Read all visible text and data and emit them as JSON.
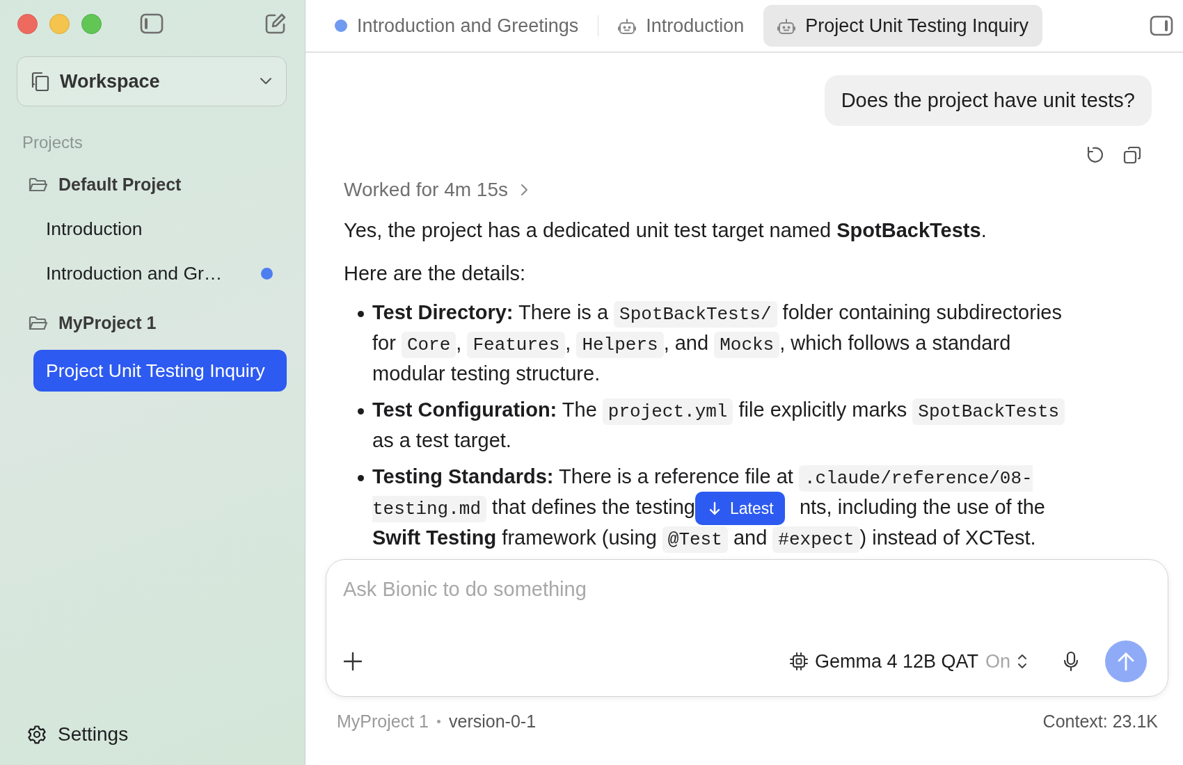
{
  "sidebar": {
    "workspace": {
      "label": "Workspace"
    },
    "section_title": "Projects",
    "projects": [
      {
        "name": "Default Project",
        "children": [
          {
            "title": "Introduction",
            "selected": false,
            "unread": false
          },
          {
            "title": "Introduction and Gr…",
            "selected": false,
            "unread": true
          }
        ]
      },
      {
        "name": "MyProject 1",
        "children": [
          {
            "title": "Project Unit Testing Inquiry",
            "selected": true,
            "unread": false
          }
        ]
      }
    ],
    "settings": {
      "label": "Settings"
    }
  },
  "tabs": [
    {
      "label": "Introduction and Greetings",
      "kind": "dot",
      "selected": false
    },
    {
      "label": "Introduction",
      "kind": "robot",
      "selected": false
    },
    {
      "label": "Project Unit Testing Inquiry",
      "kind": "robot",
      "selected": true
    }
  ],
  "conversation": {
    "user_message": "Does the project have unit tests?",
    "worked_for": "Worked for 4m 15s",
    "paragraphs": [
      "Yes, the project has a dedicated unit test target named **SpotBackTests**.",
      "Here are the details:"
    ],
    "bullets": [
      [
        {
          "kind": "text",
          "text": "**Test Directory:** There is a "
        },
        {
          "kind": "code",
          "text": "SpotBackTests/"
        },
        {
          "kind": "text",
          "text": " folder containing subdirectories for "
        },
        {
          "kind": "code",
          "text": "Core"
        },
        {
          "kind": "text",
          "text": ", "
        },
        {
          "kind": "code",
          "text": "Features"
        },
        {
          "kind": "text",
          "text": ", "
        },
        {
          "kind": "code",
          "text": "Helpers"
        },
        {
          "kind": "text",
          "text": ", and "
        },
        {
          "kind": "code",
          "text": "Mocks"
        },
        {
          "kind": "text",
          "text": ", which follows a standard modular testing structure."
        }
      ],
      [
        {
          "kind": "text",
          "text": "**Test Configuration:** The "
        },
        {
          "kind": "code",
          "text": "project.yml"
        },
        {
          "kind": "text",
          "text": " file explicitly marks "
        },
        {
          "kind": "code",
          "text": "SpotBackTests"
        },
        {
          "kind": "text",
          "text": " as a test target."
        }
      ],
      [
        {
          "kind": "text",
          "text": "**Testing Standards:** There is a reference file at "
        },
        {
          "kind": "code",
          "text": ".claude/reference/08-testing.md"
        },
        {
          "kind": "text",
          "text": " that defines the testing"
        },
        {
          "kind": "jump",
          "label": "Latest"
        },
        {
          "kind": "text",
          "text": "nts, including the use of the **Swift Testing** framework (using "
        },
        {
          "kind": "code",
          "text": "@Test"
        },
        {
          "kind": "text",
          "text": " and "
        },
        {
          "kind": "code",
          "text": "#expect"
        },
        {
          "kind": "text",
          "text": ") instead of XCTest."
        }
      ]
    ]
  },
  "composer": {
    "placeholder": "Ask Bionic to do something",
    "model": "Gemma 4 12B QAT",
    "reasoning": "On",
    "send_enabled": false
  },
  "status_bar": {
    "project": "MyProject 1",
    "branch": "version-0-1",
    "context": "Context: 23.1K"
  }
}
